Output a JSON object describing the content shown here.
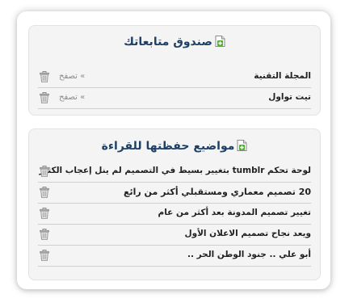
{
  "follow_box": {
    "title": "صندوق متابعاتك",
    "items": [
      {
        "label": "المجلة التقنية",
        "browse": "» تصفح"
      },
      {
        "label": "تيت تواول",
        "browse": "» تصفح"
      }
    ]
  },
  "saved_box": {
    "title": "مواضيع حفظتها للقراءة",
    "items": [
      {
        "label": "لوحة تحكم tumblr بتغيير بسيط في التصميم لم ينل إعجاب الكثير"
      },
      {
        "label": "20 تصميم معماري ومستقبلي أكثر من رائع"
      },
      {
        "label": "تغيير تصميم المدونة بعد أكثر من عام"
      },
      {
        "label": "ويعد نجاح تصميم الاعلان الأول"
      },
      {
        "label": "أبو علي .. جنود الوطن الحر .."
      }
    ]
  },
  "icons": {
    "title_icon": "document-add-icon",
    "row_icon": "trash-icon"
  },
  "colors": {
    "title": "#1e3f66",
    "panel_bg": "#f4f4f4",
    "row_text": "#222222",
    "browse_text": "#8a8a8a"
  }
}
